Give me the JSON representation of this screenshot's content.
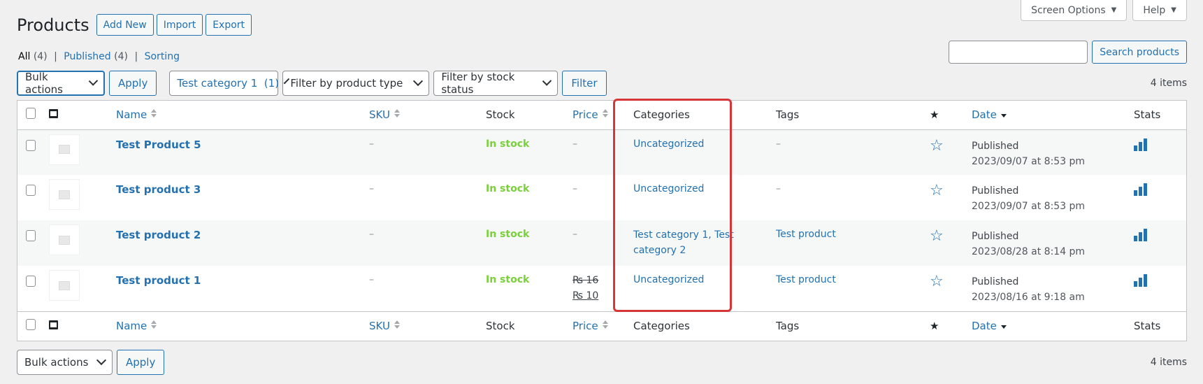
{
  "meta": {
    "screen_options": "Screen Options",
    "help": "Help"
  },
  "header": {
    "title": "Products",
    "add_new": "Add New",
    "import": "Import",
    "export": "Export"
  },
  "views": {
    "all": "All",
    "all_count": "(4)",
    "published": "Published",
    "published_count": "(4)",
    "sorting": "Sorting",
    "sep": "|"
  },
  "search": {
    "button": "Search products",
    "placeholder": ""
  },
  "tablenav_top": {
    "bulk_actions": "Bulk actions",
    "apply": "Apply",
    "category_filter": "Test category 1  (1)",
    "product_type_filter": "Filter by product type",
    "stock_status_filter": "Filter by stock status",
    "filter": "Filter",
    "items": "4 items"
  },
  "tablenav_bottom": {
    "bulk_actions": "Bulk actions",
    "apply": "Apply",
    "items": "4 items"
  },
  "columns": {
    "name": "Name",
    "sku": "SKU",
    "stock": "Stock",
    "price": "Price",
    "categories": "Categories",
    "tags": "Tags",
    "date": "Date",
    "stats": "Stats"
  },
  "rows": [
    {
      "name": "Test Product 5",
      "sku": "–",
      "stock": "In stock",
      "price": "–",
      "price_regular": "",
      "price_sale": "",
      "categories": "Uncategorized",
      "tags": "–",
      "status": "Published",
      "date": "2023/09/07 at 8:53 pm"
    },
    {
      "name": "Test product 3",
      "sku": "–",
      "stock": "In stock",
      "price": "–",
      "price_regular": "",
      "price_sale": "",
      "categories": "Uncategorized",
      "tags": "–",
      "status": "Published",
      "date": "2023/09/07 at 8:53 pm"
    },
    {
      "name": "Test product 2",
      "sku": "–",
      "stock": "In stock",
      "price": "–",
      "price_regular": "",
      "price_sale": "",
      "categories": "Test category 1, Test category 2",
      "tags": "Test product",
      "status": "Published",
      "date": "2023/08/28 at 8:14 pm"
    },
    {
      "name": "Test product 1",
      "sku": "–",
      "stock": "In stock",
      "price": "",
      "price_regular": "₨ 16",
      "price_sale": "₨ 10",
      "categories": "Uncategorized",
      "tags": "Test product",
      "status": "Published",
      "date": "2023/08/16 at 9:18 am"
    }
  ],
  "colors": {
    "accent": "#2271b1",
    "in_stock": "#7ad03a",
    "highlight": "#d63638"
  }
}
